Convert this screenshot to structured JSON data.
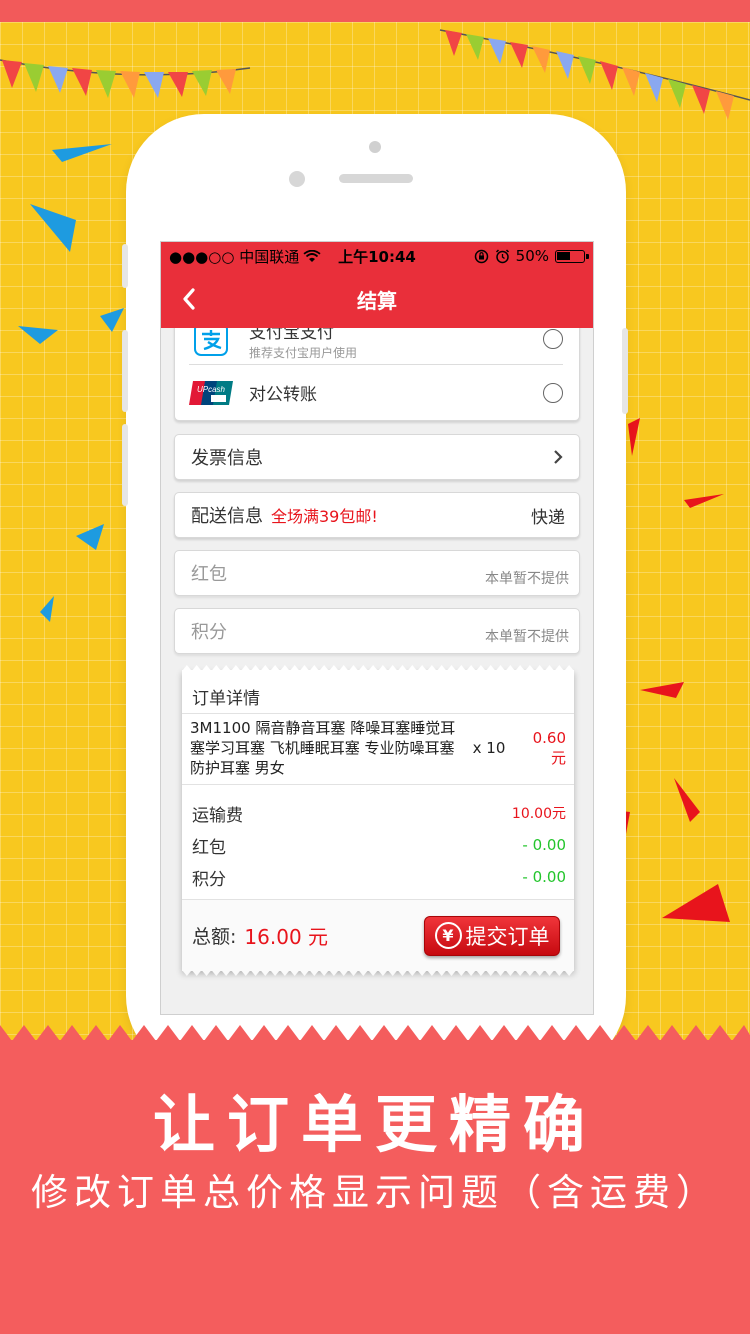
{
  "status_bar": {
    "carrier": "●●●○○ 中国联通",
    "time": "上午10:44",
    "battery": "50%"
  },
  "nav": {
    "title": "结算"
  },
  "payment": {
    "alipay_title": "支付宝支付",
    "alipay_sub": "推荐支付宝用户使用",
    "transfer_title": "对公转账"
  },
  "invoice": {
    "label": "发票信息"
  },
  "delivery": {
    "label": "配送信息",
    "promo": "全场满39包邮!",
    "method": "快递"
  },
  "red_packet": {
    "placeholder": "红包",
    "note": "本单暂不提供"
  },
  "points": {
    "placeholder": "积分",
    "note": "本单暂不提供"
  },
  "order": {
    "heading": "订单详情",
    "items": [
      {
        "name": "3M1100 隔音静音耳塞 降噪耳塞睡觉耳塞学习耳塞 飞机睡眠耳塞 专业防噪耳塞 防护耳塞 男女",
        "qty": "x 10",
        "price": "0.60元"
      }
    ],
    "fees": [
      {
        "label": "运输费",
        "value": "10.00元"
      },
      {
        "label": "红包",
        "value": "- 0.00"
      },
      {
        "label": "积分",
        "value": "- 0.00"
      }
    ],
    "total_label": "总额:",
    "total_value": "16.00 元",
    "submit_label": "提交订单",
    "yuan_symbol": "¥"
  },
  "promo_banner": {
    "headline": "让订单更精确",
    "subline": "修改订单总价格显示问题（含运费）"
  },
  "colors": {
    "nav_red": "#e92f3a",
    "price_red": "#e8141c",
    "discount_green": "#23c52c",
    "background_yellow": "#f8c81f",
    "bottom_red": "#f45d5d"
  },
  "icons": [
    "back-chevron-icon",
    "wifi-icon",
    "lock-rotation-icon",
    "alarm-icon",
    "battery-icon",
    "alipay-icon",
    "unionpay-icon",
    "chevron-right-icon",
    "yuan-icon"
  ]
}
